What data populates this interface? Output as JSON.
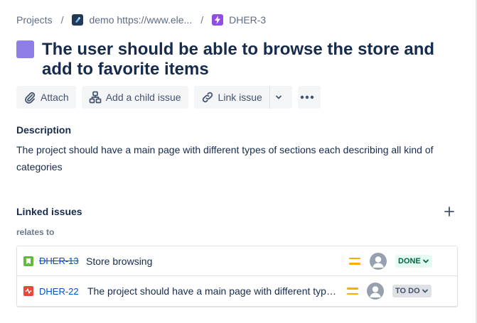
{
  "breadcrumb": {
    "projects_label": "Projects",
    "separator": "/",
    "project_label": "demo https://www.ele...",
    "issue_key": "DHER-3"
  },
  "issue": {
    "title": "The user should be able to browse the store and add to favorite items",
    "epic_color": "#8f7ee7"
  },
  "toolbar": {
    "attach_label": "Attach",
    "add_child_label": "Add a child issue",
    "link_issue_label": "Link issue"
  },
  "description": {
    "label": "Description",
    "text": "The project should have a main page with different types of sections each describing all kind of categories"
  },
  "linked_issues": {
    "label": "Linked issues",
    "relation_label": "relates to",
    "items": [
      {
        "key": "DHER-13",
        "summary": "Store browsing",
        "type_icon": "story-icon",
        "priority_icon": "priority-medium-icon",
        "status": "DONE",
        "status_color": "#006644",
        "resolved": true
      },
      {
        "key": "DHER-22",
        "summary": "The project should have a main page with different types of sections each describing all kind of categories",
        "type_icon": "bug-icon",
        "priority_icon": "priority-medium-icon",
        "status": "TO DO",
        "status_color": "#42526e",
        "resolved": false
      }
    ]
  },
  "colors": {
    "link": "#0052cc",
    "text": "#172b4d",
    "priority_medium": "#ffab00"
  }
}
